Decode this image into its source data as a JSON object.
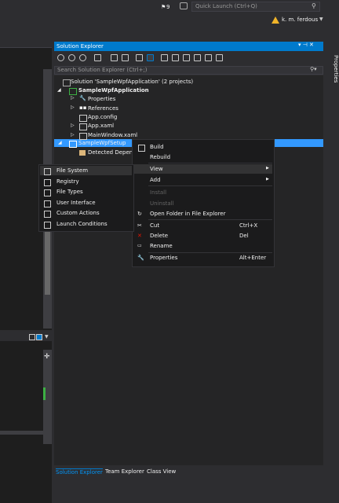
{
  "topbar": {
    "notification_count": "9",
    "quick_launch_placeholder": "Quick Launch (Ctrl+Q)",
    "user_name": "k. m. ferdous"
  },
  "solution_explorer": {
    "title": "Solution Explorer",
    "search_placeholder": "Search Solution Explorer (Ctrl+;)",
    "tree": {
      "solution": "Solution 'SampleWpfApplication' (2 projects)",
      "project": "SampleWpfApplication",
      "properties": "Properties",
      "references": "References",
      "app_config": "App.config",
      "app_xaml": "App.xaml",
      "main_window": "MainWindow.xaml",
      "setup_project": "SampleWpfSetup",
      "detected": "Detected Depend"
    },
    "tabs": [
      "Solution Explorer",
      "Team Explorer",
      "Class View"
    ],
    "side_panel": "Properties"
  },
  "context_menu": {
    "build": "Build",
    "rebuild": "Rebuild",
    "view": "View",
    "add": "Add",
    "install": "Install",
    "uninstall": "Uninstall",
    "open_folder": "Open Folder in File Explorer",
    "cut": "Cut",
    "cut_shortcut": "Ctrl+X",
    "delete": "Delete",
    "delete_shortcut": "Del",
    "rename": "Rename",
    "properties": "Properties",
    "properties_shortcut": "Alt+Enter"
  },
  "view_submenu": {
    "file_system": "File System",
    "registry": "Registry",
    "file_types": "File Types",
    "user_interface": "User Interface",
    "custom_actions": "Custom Actions",
    "launch_conditions": "Launch Conditions"
  },
  "colors": {
    "accent": "#007acc",
    "selection": "#3399ff",
    "background": "#2d2d30",
    "warning": "#f0b429"
  }
}
